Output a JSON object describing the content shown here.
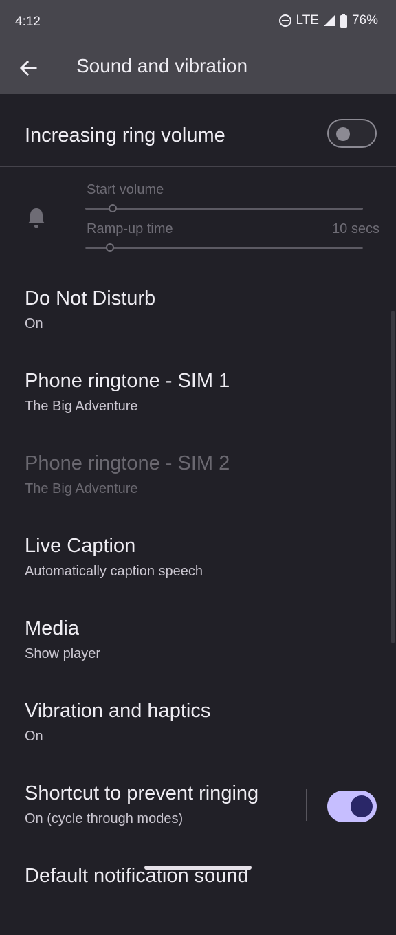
{
  "status_bar": {
    "time": "4:12",
    "network": "LTE",
    "battery": "76%",
    "icons": [
      "do-not-disturb-icon",
      "signal-icon",
      "battery-icon"
    ]
  },
  "app_bar": {
    "title": "Sound and vibration",
    "back_icon": "arrow-back-icon"
  },
  "increasing_ring": {
    "label": "Increasing ring volume",
    "enabled": false
  },
  "ramp": {
    "icon": "bell-icon",
    "start_volume_label": "Start volume",
    "start_volume_fraction": 0.1,
    "ramp_up_label": "Ramp-up time",
    "ramp_up_value": "10 secs",
    "ramp_up_fraction": 0.09
  },
  "items": [
    {
      "title": "Do Not Disturb",
      "subtitle": "On",
      "disabled": false
    },
    {
      "title": "Phone ringtone - SIM 1",
      "subtitle": "The Big Adventure",
      "disabled": false
    },
    {
      "title": "Phone ringtone - SIM 2",
      "subtitle": "The Big Adventure",
      "disabled": true
    },
    {
      "title": "Live Caption",
      "subtitle": "Automatically caption speech",
      "disabled": false
    },
    {
      "title": "Media",
      "subtitle": "Show player",
      "disabled": false
    },
    {
      "title": "Vibration and haptics",
      "subtitle": "On",
      "disabled": false
    },
    {
      "title": "Shortcut to prevent ringing",
      "subtitle": "On (cycle through modes)",
      "disabled": false,
      "toggle": true
    },
    {
      "title": "Default notification sound",
      "subtitle": "",
      "disabled": false
    }
  ],
  "colors": {
    "background": "#212027",
    "app_bar": "#47464d",
    "switch_on": "#c6beff",
    "switch_knob_on": "#2a2768"
  }
}
